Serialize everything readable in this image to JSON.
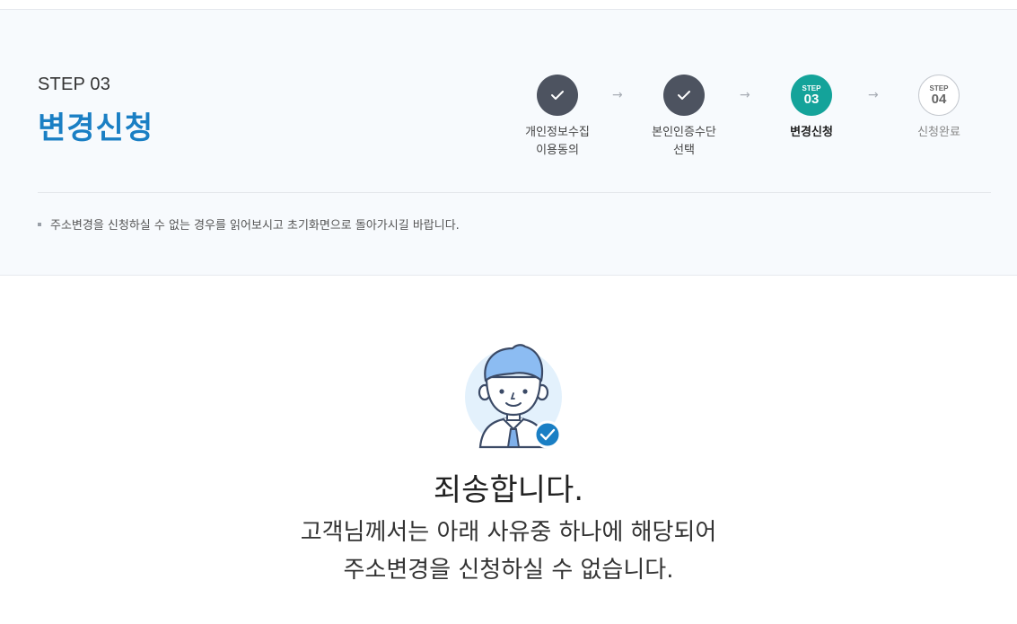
{
  "header": {
    "step_label": "STEP 03",
    "title": "변경신청"
  },
  "steps": [
    {
      "label_line1": "개인정보수집",
      "label_line2": "이용동의",
      "state": "done"
    },
    {
      "label_line1": "본인인증수단",
      "label_line2": "선택",
      "state": "done"
    },
    {
      "small": "STEP",
      "num": "03",
      "label_line1": "변경신청",
      "state": "current"
    },
    {
      "small": "STEP",
      "num": "04",
      "label_line1": "신청완료",
      "state": "todo"
    }
  ],
  "arrow_glyph": "→",
  "notice": "주소변경을 신청하실 수 없는 경우를 읽어보시고 초기화면으로 돌아가시길 바랍니다.",
  "message": {
    "title": "죄송합니다.",
    "line1": "고객님께서는 아래 사유중 하나에 해당되어",
    "line2": "주소변경을 신청하실 수 없습니다."
  },
  "colors": {
    "accent_blue": "#1a7fc4",
    "step_current": "#14a39a",
    "step_done": "#4d5360"
  }
}
